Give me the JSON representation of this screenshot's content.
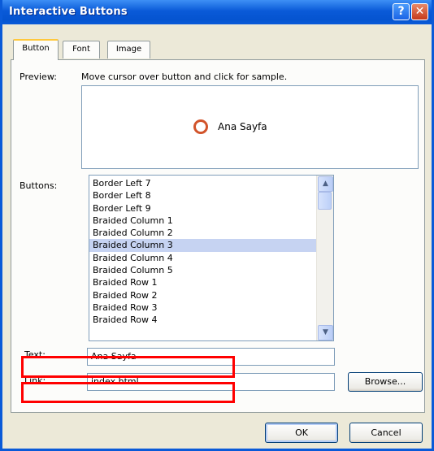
{
  "window": {
    "title": "Interactive Buttons"
  },
  "titlebar": {
    "help_icon": "?",
    "close_icon": "✕"
  },
  "tabs": [
    {
      "label": "Button",
      "active": true
    },
    {
      "label": "Font",
      "active": false
    },
    {
      "label": "Image",
      "active": false
    }
  ],
  "preview": {
    "label": "Preview:",
    "hint": "Move cursor over button and click for sample.",
    "sample_button_text": "Ana Sayfa"
  },
  "buttons": {
    "label": "Buttons:",
    "items": [
      "Border Left 7",
      "Border Left 8",
      "Border Left 9",
      "Braided Column 1",
      "Braided Column 2",
      "Braided Column 3",
      "Braided Column 4",
      "Braided Column 5",
      "Braided Row 1",
      "Braided Row 2",
      "Braided Row 3",
      "Braided Row 4"
    ],
    "selected": "Braided Column 3"
  },
  "text_field": {
    "label": "Text:",
    "value": "Ana Sayfa"
  },
  "link_field": {
    "label": "Link:",
    "value": "index.html"
  },
  "browse_label": "Browse...",
  "ok_label": "OK",
  "cancel_label": "Cancel",
  "colors": {
    "title_bar": "#0a5ad8",
    "selection": "#c6d3f2",
    "annotation": "#ff0000"
  }
}
